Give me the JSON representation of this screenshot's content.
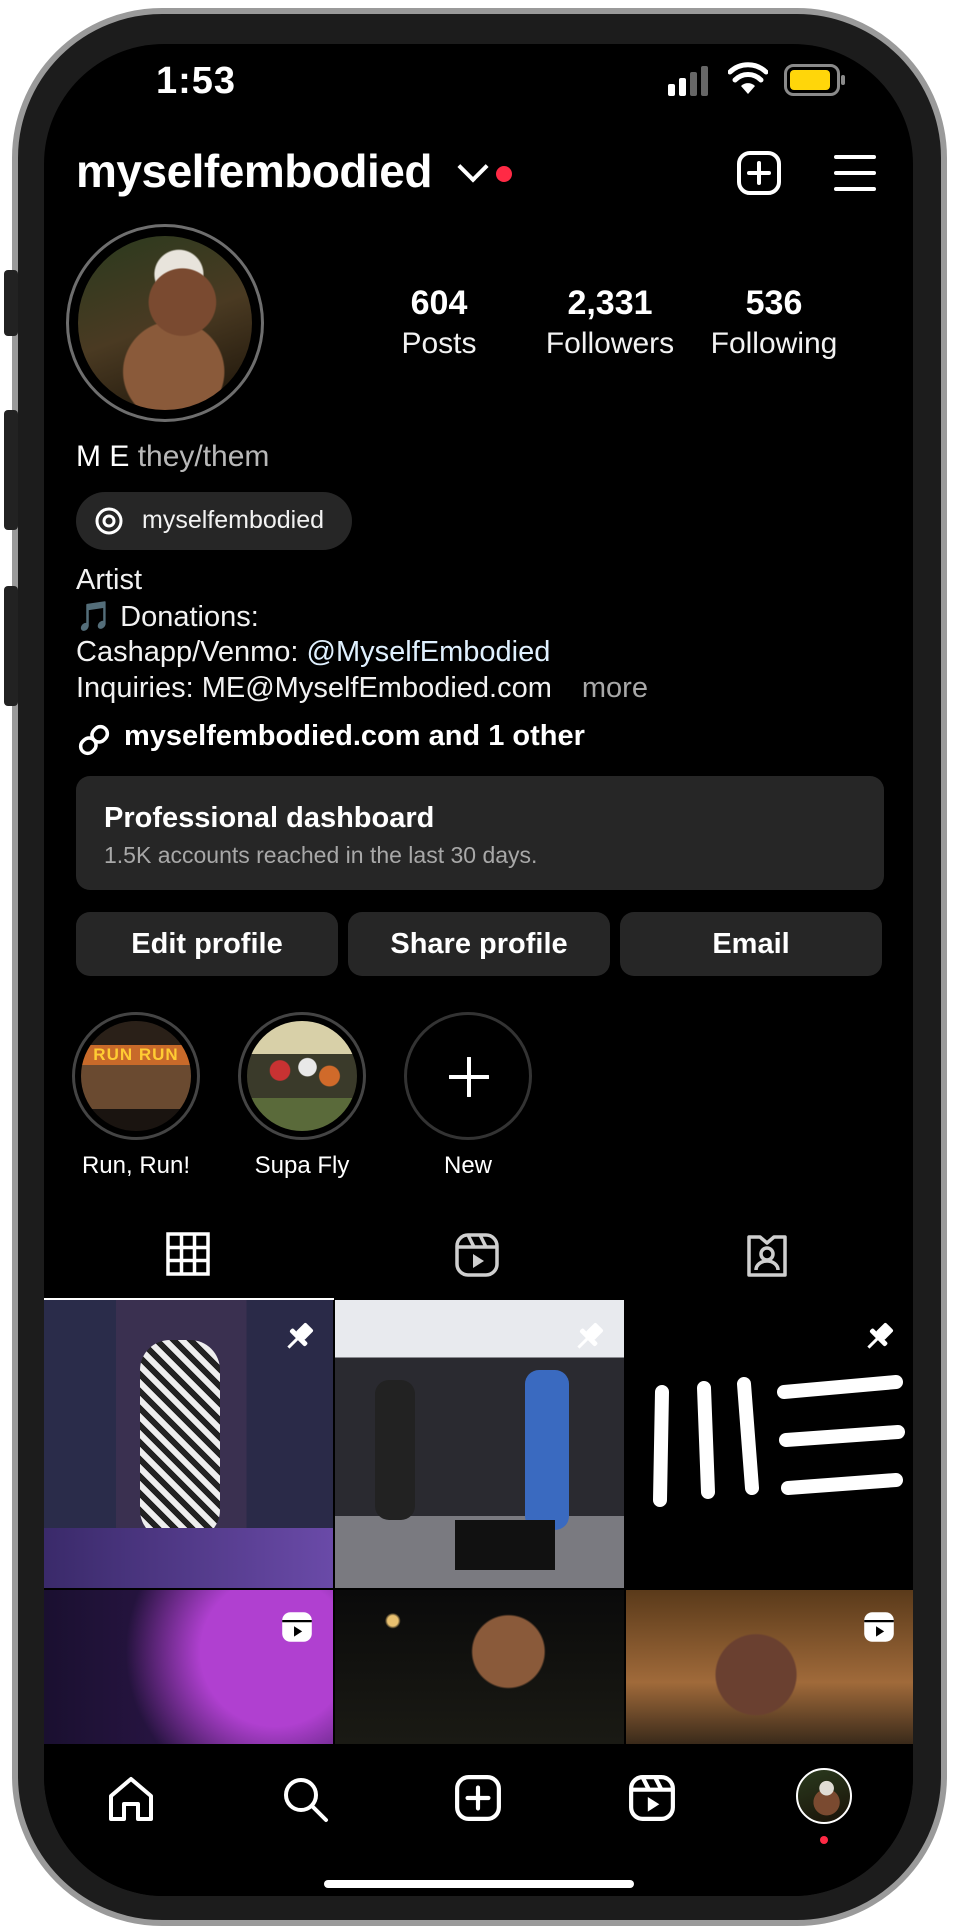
{
  "status_bar": {
    "time": "1:53"
  },
  "header": {
    "username": "myselfembodied"
  },
  "stats": [
    {
      "num": "604",
      "label": "Posts"
    },
    {
      "num": "2,331",
      "label": "Followers"
    },
    {
      "num": "536",
      "label": "Following"
    }
  ],
  "profile": {
    "name": "M E",
    "pronouns": "they/them",
    "threads_handle": "myselfembodied",
    "category": "Artist",
    "bio_line1": "🎵 Donations:",
    "bio_line2_prefix": "Cashapp/Venmo: ",
    "bio_line2_handle": "@MyselfEmbodied",
    "bio_line3": "Inquiries: ME@MyselfEmbodied.com",
    "more": "more",
    "links": "myselfembodied.com and 1 other"
  },
  "dashboard": {
    "title": "Professional dashboard",
    "subtitle": "1.5K accounts reached in the last 30 days."
  },
  "buttons": {
    "edit": "Edit profile",
    "share": "Share profile",
    "email": "Email"
  },
  "highlights": [
    {
      "label": "Run, Run!",
      "cover_text": "RUN RUN"
    },
    {
      "label": "Supa Fly"
    },
    {
      "label": "New"
    }
  ],
  "colors": {
    "background": "#000000",
    "surface": "#262626",
    "notification": "#ff2a45",
    "link": "#e0f1ff",
    "battery": "#ffd60a"
  },
  "icons": [
    "plus-square-icon",
    "menu-icon",
    "threads-icon",
    "link-icon",
    "grid-icon",
    "reels-icon",
    "tagged-icon",
    "pin-icon",
    "home-icon",
    "search-icon",
    "create-icon",
    "profile-avatar-icon"
  ]
}
